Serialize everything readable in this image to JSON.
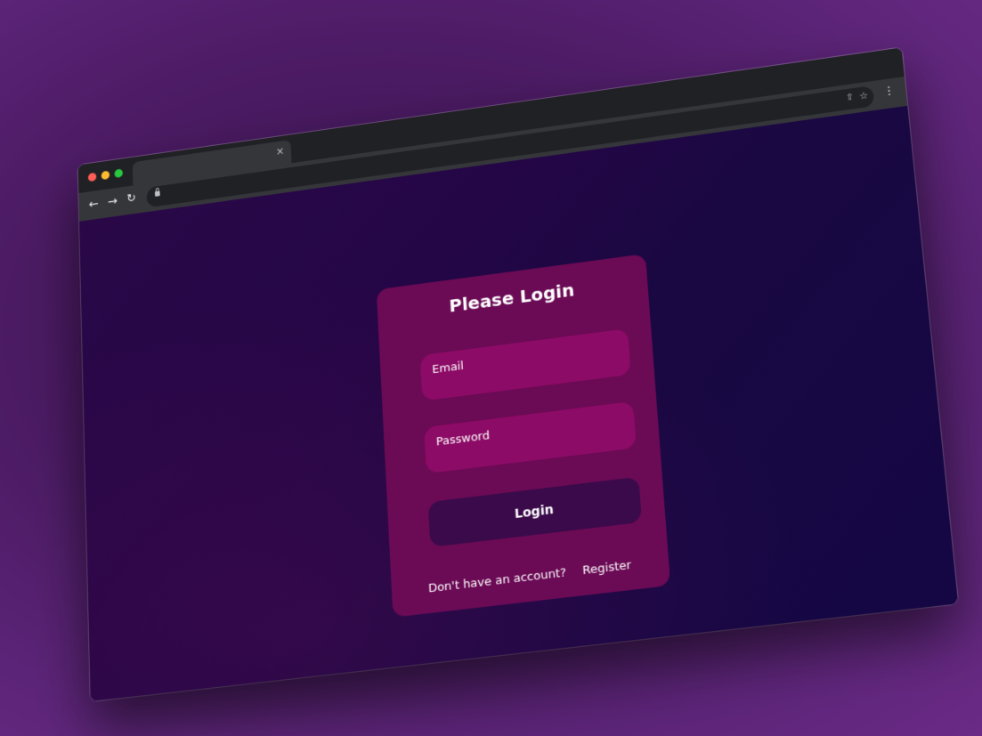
{
  "browser": {
    "tab_close_glyph": "×",
    "nav": {
      "back_icon": "arrow-left-icon",
      "forward_icon": "arrow-right-icon",
      "reload_icon": "reload-icon"
    },
    "icons": {
      "lock": "lock-icon",
      "share": "share-icon",
      "star": "star-icon",
      "menu": "kebab-menu-icon"
    }
  },
  "login": {
    "title": "Please Login",
    "email_label": "Email",
    "password_label": "Password",
    "submit_label": "Login",
    "no_account_text": "Don't have an account?",
    "register_link": "Register"
  },
  "colors": {
    "page_background": "#4a1a62",
    "viewport_start": "#2a0848",
    "viewport_end": "#140744",
    "card": "#6b0a55",
    "field": "#8c0b66",
    "button": "#3a0a4a",
    "text": "#ffffff"
  }
}
